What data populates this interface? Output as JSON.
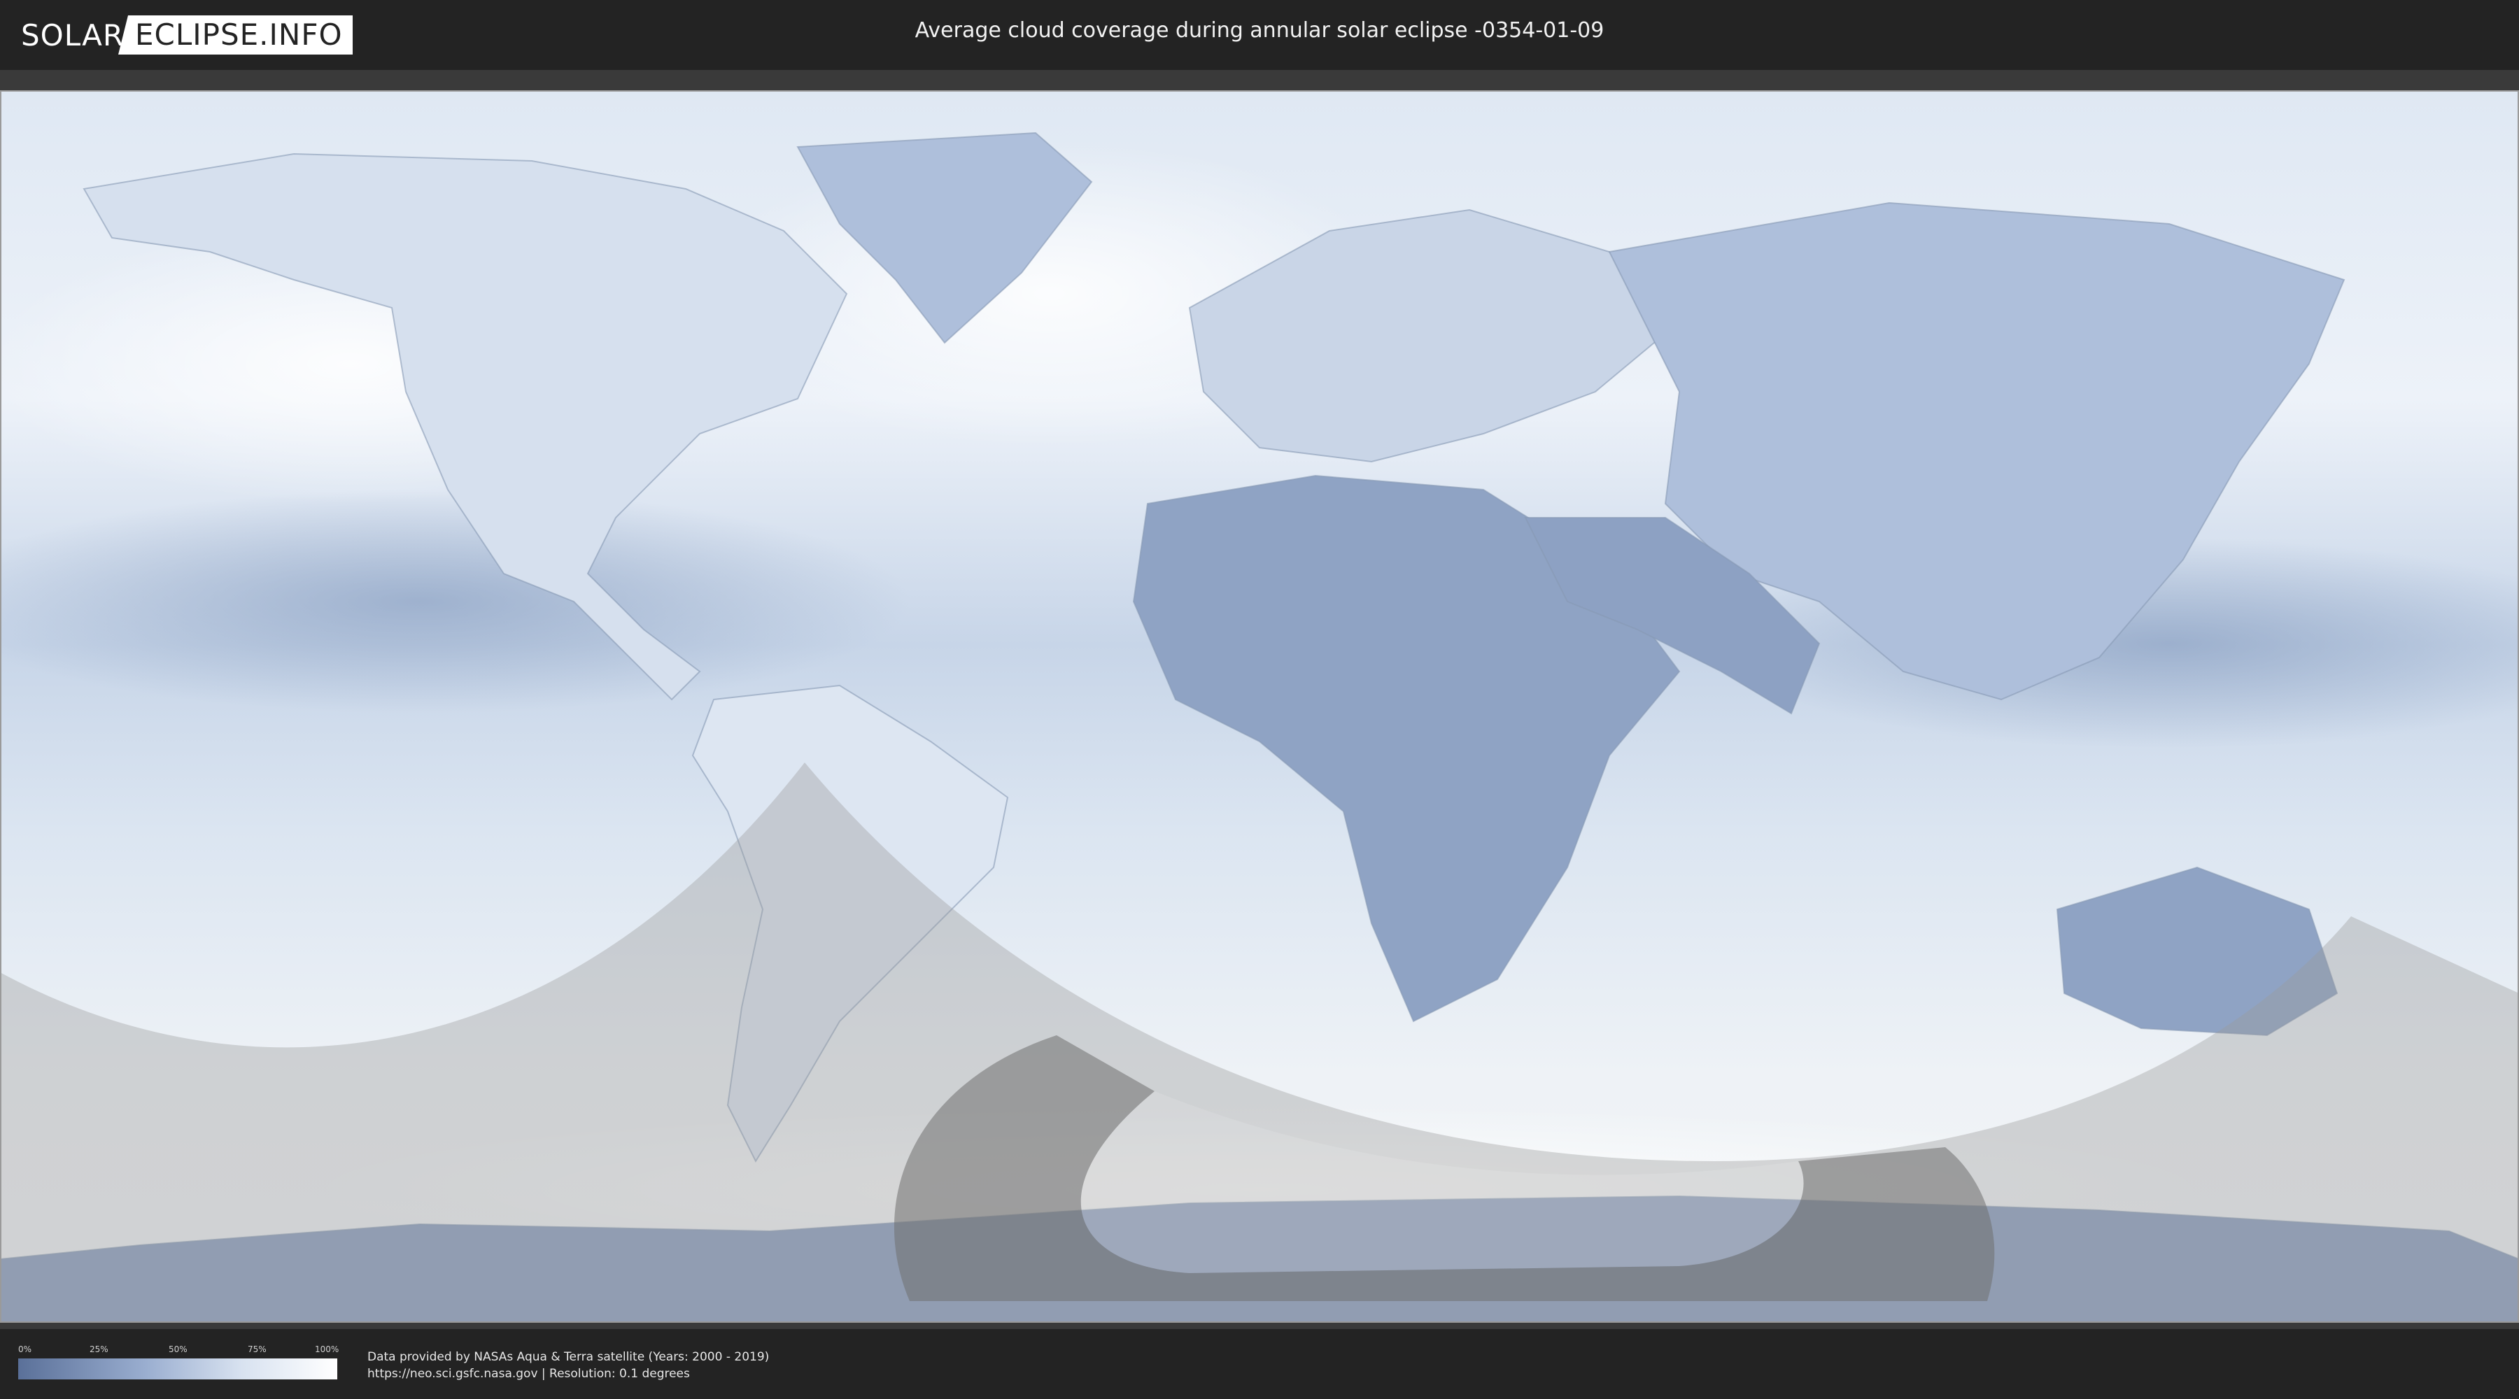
{
  "header": {
    "logo_left": "SOLAR",
    "logo_right": "ECLIPSE.INFO",
    "title": "Average cloud coverage during annular solar eclipse -0354-01-09"
  },
  "legend": {
    "ticks": [
      "0%",
      "25%",
      "50%",
      "75%",
      "100%"
    ],
    "colors": {
      "low": "#5a7099",
      "high": "#ffffff"
    }
  },
  "footer": {
    "credit_line1": "Data provided by NASAs Aqua & Terra satellite (Years: 2000 - 2019)",
    "credit_line2": "https://neo.sci.gsfc.nasa.gov | Resolution: 0.1 degrees"
  },
  "map": {
    "colors": {
      "cloud_light": "#f4f7fb",
      "cloud_mid": "#c9d6e8",
      "cloud_dark": "#7e93b8",
      "shadow_overlay": "#9a9a9a",
      "annular_path": "#6f6f6f"
    }
  }
}
